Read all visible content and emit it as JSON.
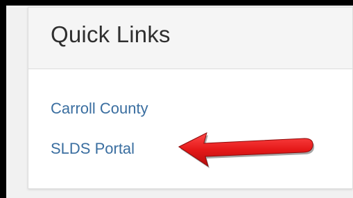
{
  "quick_links": {
    "title": "Quick Links",
    "links": [
      {
        "label": "Carroll County"
      },
      {
        "label": "SLDS Portal"
      }
    ]
  },
  "annotation": {
    "arrow_color": "#e51919",
    "pointing_to": "SLDS Portal"
  },
  "colors": {
    "link": "#3a6ea0",
    "title": "#2f2f2f",
    "header_bg": "#f5f5f5",
    "frame": "#000000"
  }
}
